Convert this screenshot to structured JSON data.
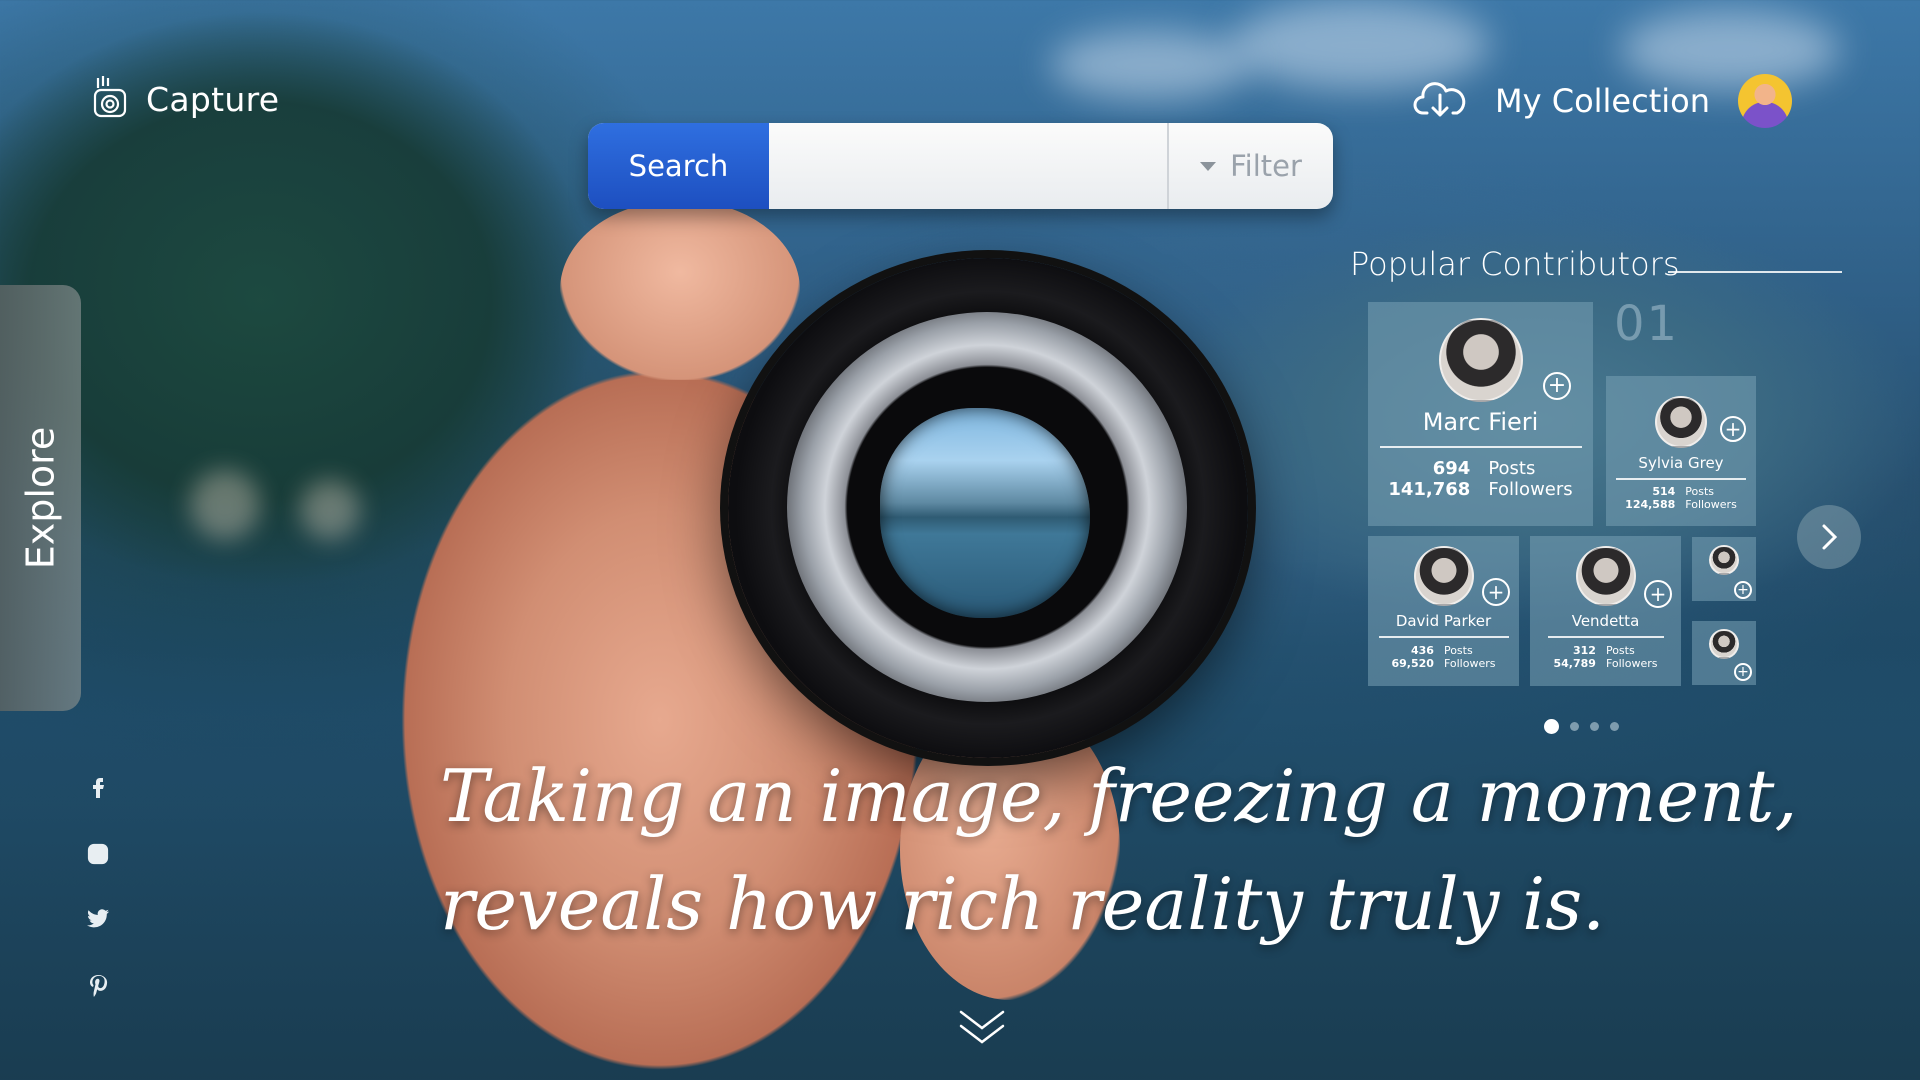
{
  "brand": {
    "name": "Capture",
    "icon": "camera-hand-icon"
  },
  "header": {
    "collection_label": "My Collection",
    "download_icon": "cloud-download-icon"
  },
  "search": {
    "button_label": "Search",
    "placeholder": "",
    "filter_label": "Filter"
  },
  "sidebar": {
    "explore_label": "Explore"
  },
  "social": [
    "facebook-icon",
    "instagram-icon",
    "twitter-icon",
    "pinterest-icon"
  ],
  "contributors": {
    "title": "Popular Contributors",
    "page_index": "01",
    "featured": {
      "name": "Marc Fieri",
      "posts": "694",
      "posts_label": "Posts",
      "followers": "141,768",
      "followers_label": "Followers"
    },
    "cards": [
      {
        "name": "Sylvia Grey",
        "posts": "514",
        "posts_label": "Posts",
        "followers": "124,588",
        "followers_label": "Followers"
      },
      {
        "name": "David Parker",
        "posts": "436",
        "posts_label": "Posts",
        "followers": "69,520",
        "followers_label": "Followers"
      },
      {
        "name": "Vendetta",
        "posts": "312",
        "posts_label": "Posts",
        "followers": "54,789",
        "followers_label": "Followers"
      }
    ],
    "add_symbol": "+",
    "pagination": {
      "total": 4,
      "active": 1
    }
  },
  "quote": {
    "line1": "Taking an image, freezing a moment,",
    "line2": "reveals how rich reality truly is."
  },
  "colors": {
    "accent": "#1d4fc0",
    "card_bg": "#78a0b4",
    "text": "#ffffff"
  }
}
